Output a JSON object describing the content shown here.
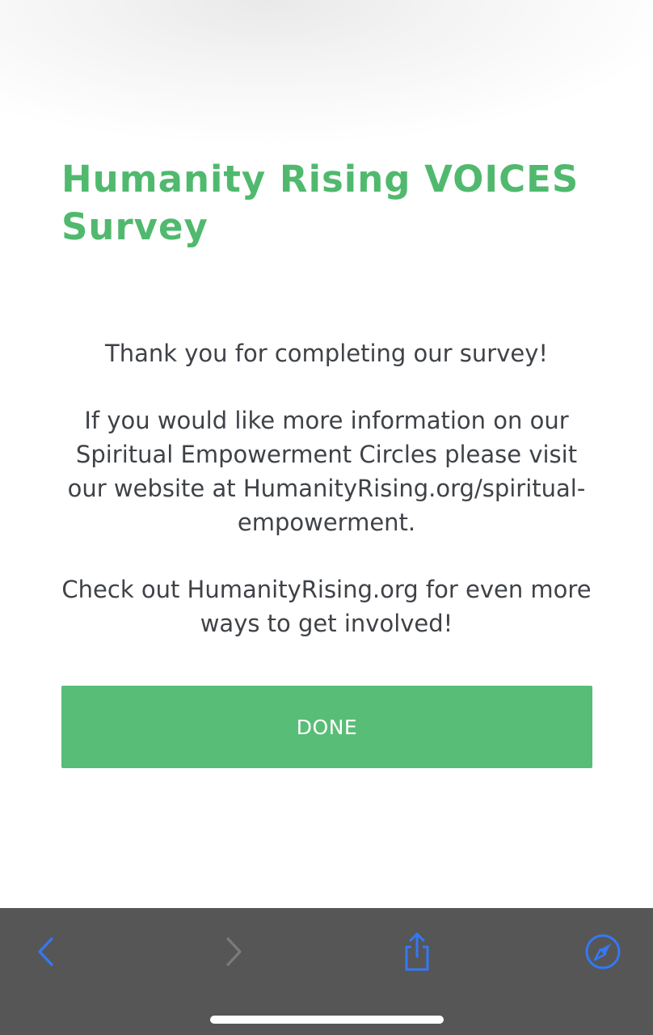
{
  "survey": {
    "title": "Humanity Rising VOICES Survey",
    "thank_you": "Thank you for completing our survey!",
    "info": "If you would like more information on our Spiritual Empowerment Circles please visit our website at HumanityRising.org/spiritual-empowerment.",
    "cta": "Check out HumanityRising.org for even more ways to get involved!",
    "done_label": "DONE"
  },
  "browser_toolbar": {
    "back_icon": "chevron-left-icon",
    "forward_icon": "chevron-right-icon",
    "share_icon": "share-icon",
    "safari_icon": "compass-icon",
    "active_color": "#3478f6",
    "disabled_color": "#7a7a7a",
    "background": "#565656"
  },
  "colors": {
    "title_green": "#50b96e",
    "button_green": "#58bd76",
    "body_text": "#3f4247"
  }
}
